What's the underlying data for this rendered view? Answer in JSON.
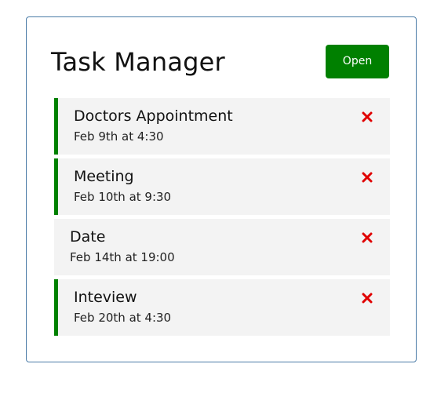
{
  "header": {
    "title": "Task Manager",
    "open_label": "Open"
  },
  "tasks": [
    {
      "text": "Doctors Appointment",
      "day": "Feb 9th at 4:30",
      "reminder": true
    },
    {
      "text": "Meeting",
      "day": "Feb 10th at 9:30",
      "reminder": true
    },
    {
      "text": "Date",
      "day": "Feb 14th at 19:00",
      "reminder": false
    },
    {
      "text": "Inteview",
      "day": "Feb 20th at 4:30",
      "reminder": true
    }
  ],
  "colors": {
    "accent": "#008000",
    "delete": "#e00000",
    "task_bg": "#f3f3f3",
    "card_border": "#4a7ba7"
  },
  "icons": {
    "delete": "close-icon"
  }
}
